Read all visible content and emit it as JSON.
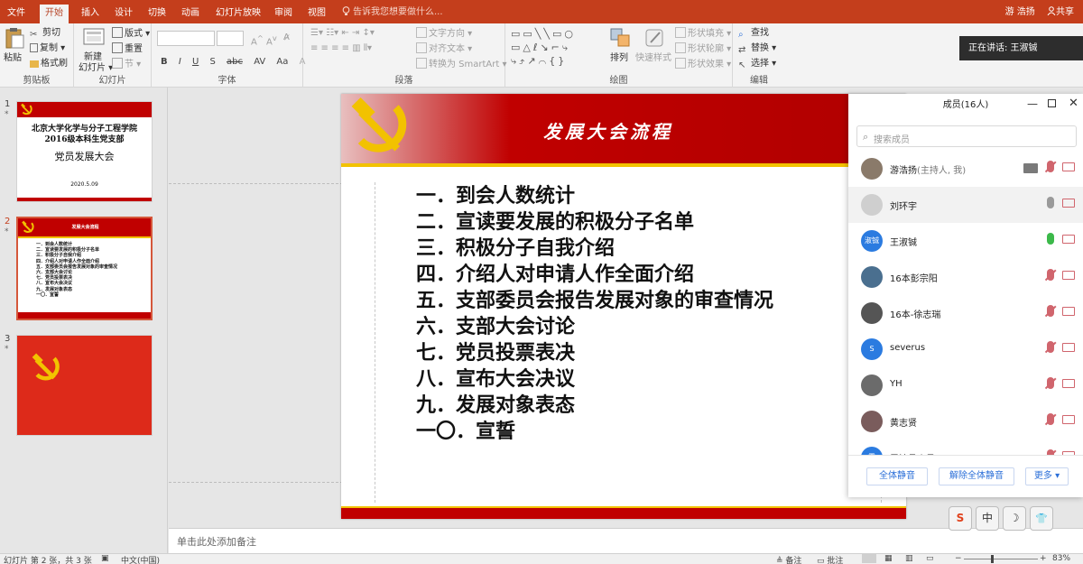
{
  "tabs": [
    "文件",
    "开始",
    "插入",
    "设计",
    "切换",
    "动画",
    "幻灯片放映",
    "审阅",
    "视图"
  ],
  "active_tab": "开始",
  "tell_me": "告诉我您想要做什么...",
  "user": "游 浩扬",
  "share": "共享",
  "ribbon": {
    "clipboard": {
      "paste": "粘贴",
      "cut": "剪切",
      "copy": "复制",
      "format_painter": "格式刷",
      "label": "剪贴板"
    },
    "slides": {
      "new_slide": "新建",
      "new_slide2": "幻灯片",
      "layout": "版式",
      "reset": "重置",
      "section": "节",
      "label": "幻灯片"
    },
    "font": {
      "buttons": [
        "B",
        "I",
        "U",
        "S",
        "abc",
        "AV",
        "Aa",
        "A"
      ],
      "label": "字体"
    },
    "paragraph": {
      "text_direction": "文字方向",
      "align_text": "对齐文本",
      "smartart": "转换为 SmartArt",
      "label": "段落"
    },
    "drawing": {
      "arrange": "排列",
      "quick_styles": "快速样式",
      "shape_fill": "形状填充",
      "shape_outline": "形状轮廓",
      "shape_effects": "形状效果",
      "label": "绘图"
    },
    "editing": {
      "find": "查找",
      "replace": "替换",
      "select": "选择",
      "label": "编辑"
    }
  },
  "thumbnails": [
    {
      "num": "1",
      "title_line1": "北京大学化学与分子工程学院",
      "title_line2": "2016级本科生党支部",
      "subtitle": "党员发展大会",
      "date": "2020.5.09"
    },
    {
      "num": "2",
      "title": "发展大会流程",
      "items": [
        "一．到会人数统计",
        "二．宣读要发展的积极分子名单",
        "三．积极分子自我介绍",
        "四．介绍人对申请人作全面介绍",
        "五．支部委员会报告发展对象的审查情况",
        "六．支部大会讨论",
        "七．党员投票表决",
        "八．宣布大会决议",
        "九．发展对象表态",
        "一〇．宣誓"
      ]
    },
    {
      "num": "3"
    }
  ],
  "slide": {
    "title": "发展大会流程",
    "items": [
      "一．到会人数统计",
      "二．宣读要发展的积极分子名单",
      "三．积极分子自我介绍",
      "四．介绍人对申请人作全面介绍",
      "五．支部委员会报告发展对象的审查情况",
      "六．支部大会讨论",
      "七．党员投票表决",
      "八．宣布大会决议",
      "九．发展对象表态",
      "一〇．宣誓"
    ]
  },
  "notes_placeholder": "单击此处添加备注",
  "status": {
    "slide_info": "幻灯片 第 2 张，共 3 张",
    "language": "中文(中国)",
    "notes": "备注",
    "comments": "批注",
    "zoom": "83%"
  },
  "speaking": "正在讲话: 王淑铖",
  "meeting": {
    "title": "成员(16人)",
    "search_placeholder": "搜索成员",
    "members": [
      {
        "name": "游浩扬",
        "role": "(主持人, 我)",
        "avatar_color": "#8a7a6a",
        "mic": "muted",
        "screen": true
      },
      {
        "name": "刘环宇",
        "role": "",
        "avatar_color": "#cfcfcf",
        "mic": "off"
      },
      {
        "name": "王淑铖",
        "role": "",
        "avatar_color": "#2b7be0",
        "avatar_text": "淑铖",
        "mic": "active"
      },
      {
        "name": "16本彭宗阳",
        "role": "",
        "avatar_color": "#4a6f8f",
        "mic": "muted"
      },
      {
        "name": "16本-徐志瑞",
        "role": "",
        "avatar_color": "#555555",
        "mic": "muted"
      },
      {
        "name": "severus",
        "role": "",
        "avatar_color": "#2b7be0",
        "avatar_text": "S",
        "mic": "muted"
      },
      {
        "name": "YH",
        "role": "",
        "avatar_color": "#6b6b6b",
        "mic": "muted"
      },
      {
        "name": "黄志贤",
        "role": "",
        "avatar_color": "#7a5c5c",
        "mic": "muted"
      },
      {
        "name": "雷锦昌小号",
        "role": "",
        "avatar_color": "#2b7be0",
        "avatar_text": "雷",
        "mic": "muted"
      }
    ],
    "mute_all": "全体静音",
    "unmute_all": "解除全体静音",
    "more": "更多"
  },
  "ime": {
    "keys": [
      "S",
      "中",
      "☽",
      "👕"
    ]
  },
  "colors": {
    "accent": "#c43e1c",
    "slide_red": "#c00000",
    "gold": "#f2c200",
    "mic_active": "#3cb94a",
    "mic_muted": "#d0656d"
  }
}
